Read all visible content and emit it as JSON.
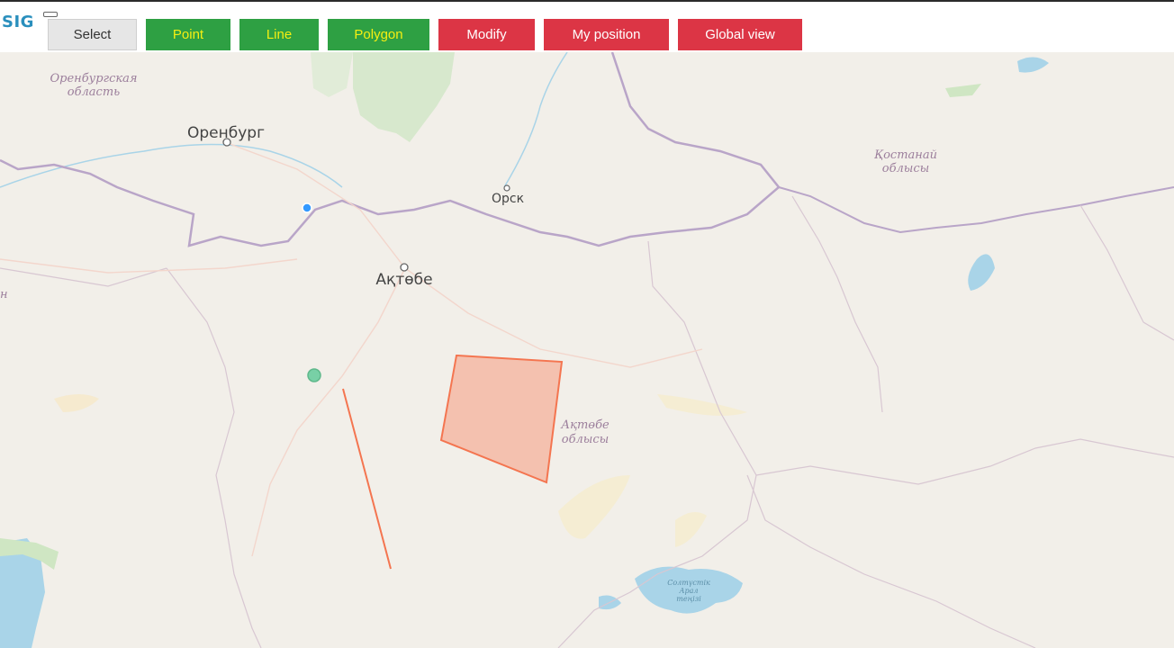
{
  "app": {
    "title": "SIG"
  },
  "toolbar": {
    "select": "Select",
    "point": "Point",
    "line": "Line",
    "polygon": "Polygon",
    "modify": "Modify",
    "my_position": "My position",
    "global_view": "Global view"
  },
  "map": {
    "labels": {
      "orenburg_region_1": "Оренбургская",
      "orenburg_region_2": "область",
      "orenburg_city": "Оренбург",
      "orsk": "Орск",
      "aktobe_city": "Ақтөбе",
      "kostanay_region_1": "Қостанай",
      "kostanay_region_2": "облысы",
      "aktobe_region_1": "Ақтөбе",
      "aktobe_region_2": "облысы",
      "aral_1": "Солтүстік",
      "aral_2": "Арал",
      "aral_3": "теңізі",
      "partial_left": "н"
    },
    "colors": {
      "land": "#f2efe9",
      "forest": "#d2e6c8",
      "water": "#a9d4e8",
      "border": "#b9a5c8",
      "feature_fill": "#f5b9a4",
      "feature_stroke": "#f47550",
      "position_dot": "#3399ff",
      "point_marker": "#78d0a6"
    }
  }
}
